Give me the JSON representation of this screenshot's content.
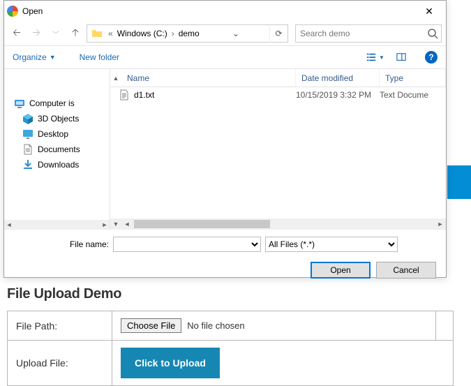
{
  "dialog": {
    "title": "Open",
    "breadcrumb": {
      "root": "Windows (C:)",
      "sub": "demo",
      "search_placeholder": "Search demo"
    },
    "toolbar": {
      "organize": "Organize",
      "new_folder": "New folder"
    },
    "sidebar": {
      "root": "Computer is",
      "items": [
        {
          "label": "3D Objects",
          "icon": "cube"
        },
        {
          "label": "Desktop",
          "icon": "desktop"
        },
        {
          "label": "Documents",
          "icon": "doc"
        },
        {
          "label": "Downloads",
          "icon": "download"
        }
      ]
    },
    "columns": {
      "name": "Name",
      "date": "Date modified",
      "type": "Type"
    },
    "files": [
      {
        "name": "d1.txt",
        "date": "10/15/2019 3:32 PM",
        "type": "Text Docume"
      }
    ],
    "filename_label": "File name:",
    "filter": "All Files (*.*)",
    "open_btn": "Open",
    "cancel_btn": "Cancel"
  },
  "page": {
    "heading": "File Upload Demo",
    "row1_label": "File Path:",
    "choose_btn": "Choose File",
    "no_file": "No file chosen",
    "row2_label": "Upload File:",
    "upload_btn": "Click to Upload"
  }
}
